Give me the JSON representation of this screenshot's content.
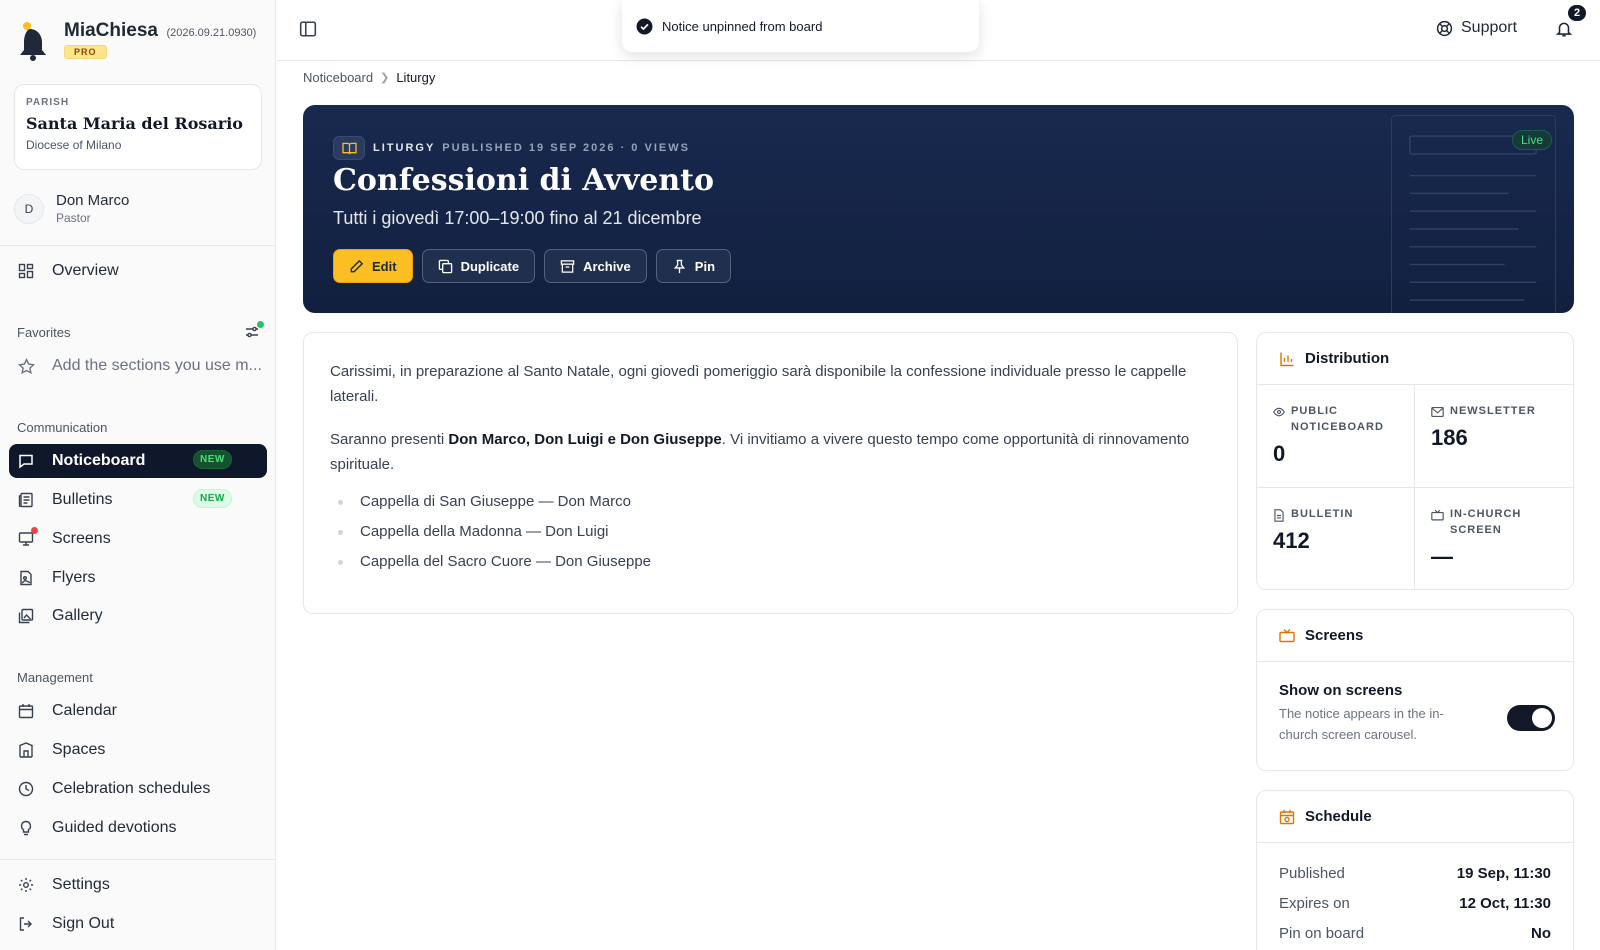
{
  "brand": {
    "name": "MiaChiesa",
    "version": "(2026.09.21.0930)",
    "badge": "PRO"
  },
  "parish": {
    "label": "PARISH",
    "name": "Santa Maria del Rosario",
    "diocese": "Diocese of Milano"
  },
  "user": {
    "initial": "D",
    "name": "Don Marco",
    "role": "Pastor"
  },
  "nav": {
    "overview": "Overview",
    "favorites_label": "Favorites",
    "favorites_hint": "Add the sections you use m...",
    "communication_label": "Communication",
    "noticeboard": "Noticeboard",
    "bulletins": "Bulletins",
    "screens": "Screens",
    "flyers": "Flyers",
    "gallery": "Gallery",
    "new_badge": "NEW",
    "management_label": "Management",
    "calendar": "Calendar",
    "spaces": "Spaces",
    "celebration_schedules": "Celebration schedules",
    "guided_devotions": "Guided devotions",
    "settings": "Settings",
    "sign_out": "Sign Out"
  },
  "topbar": {
    "support": "Support",
    "notifications_count": "2"
  },
  "toast": {
    "message": "Notice unpinned from board"
  },
  "breadcrumb": {
    "root": "Noticeboard",
    "current": "Liturgy"
  },
  "hero": {
    "category": "LITURGY",
    "published": "PUBLISHED 19 SEP 2026 · 0 VIEWS",
    "title": "Confessioni di Avvento",
    "subtitle": "Tutti i giovedì 17:00–19:00 fino al 21 dicembre",
    "buttons": {
      "edit": "Edit",
      "duplicate": "Duplicate",
      "archive": "Archive",
      "pin": "Pin"
    },
    "live_badge": "Live"
  },
  "content": {
    "p1": "Carissimi, in preparazione al Santo Natale, ogni giovedì pomeriggio sarà disponibile la confessione individuale presso le cappelle laterali.",
    "p2_pre": "Saranno presenti ",
    "p2_bold": "Don Marco, Don Luigi e Don Giuseppe",
    "p2_post": ". Vi invitiamo a vivere questo tempo come opportunità di rinnovamento spirituale.",
    "list": [
      "Cappella di San Giuseppe — Don Marco",
      "Cappella della Madonna — Don Luigi",
      "Cappella del Sacro Cuore — Don Giuseppe"
    ]
  },
  "distribution": {
    "title": "Distribution",
    "public_label": "PUBLIC NOTICEBOARD",
    "public_value": "0",
    "newsletter_label": "NEWSLETTER",
    "newsletter_value": "186",
    "bulletin_label": "BULLETIN",
    "bulletin_value": "412",
    "screen_label": "IN-CHURCH SCREEN",
    "screen_value": "—"
  },
  "screens_panel": {
    "title": "Screens",
    "toggle_title": "Show on screens",
    "toggle_desc": "The notice appears in the in-church screen carousel.",
    "toggle_on": true
  },
  "schedule": {
    "title": "Schedule",
    "rows": [
      {
        "k": "Published",
        "v": "19 Sep, 11:30"
      },
      {
        "k": "Expires on",
        "v": "12 Oct, 11:30"
      },
      {
        "k": "Pin on board",
        "v": "No"
      }
    ]
  },
  "colors": {
    "accent": "#fbbf24",
    "hero_bg": "#15254a",
    "active_nav": "#0f172a",
    "success": "#22c55e",
    "alert": "#ef4444"
  }
}
